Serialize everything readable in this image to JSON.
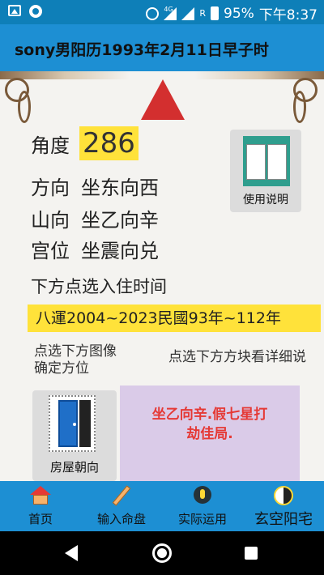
{
  "status_bar": {
    "signal_label": "4G",
    "roaming_label": "R",
    "battery": "95%",
    "time": "下午8:37"
  },
  "header": {
    "title": "sony男阳历1993年2月11日早子时"
  },
  "main": {
    "angle_label": "角度",
    "angle_value": "286",
    "rows": [
      {
        "label": "方向",
        "value": "坐东向西"
      },
      {
        "label": "山向",
        "value": "坐乙向辛"
      },
      {
        "label": "宫位",
        "value": "坐震向兑"
      }
    ],
    "help_label": "使用说明",
    "prompt": "下方点选入住时间",
    "period": "八運2004~2023民國93年~112年",
    "hint_left_1": "点选下方图像",
    "hint_left_2": "确定方位",
    "hint_right": "点选下方方块看详细说",
    "house_label": "房屋朝向",
    "result_line_1": "坐乙向辛.假七星打",
    "result_line_2": "劫佳局."
  },
  "tabs": [
    {
      "label": "首页",
      "icon": "home-icon"
    },
    {
      "label": "输入命盘",
      "icon": "pencil-icon"
    },
    {
      "label": "实际运用",
      "icon": "bulb-icon"
    },
    {
      "label": "玄空阳宅",
      "icon": "yin-yang-icon"
    }
  ],
  "colors": {
    "accent": "#1d8fd3",
    "highlight": "#ffe23a",
    "pointer": "#d32f2f",
    "result_text": "#e53935",
    "result_bg": "#dacbe8"
  }
}
